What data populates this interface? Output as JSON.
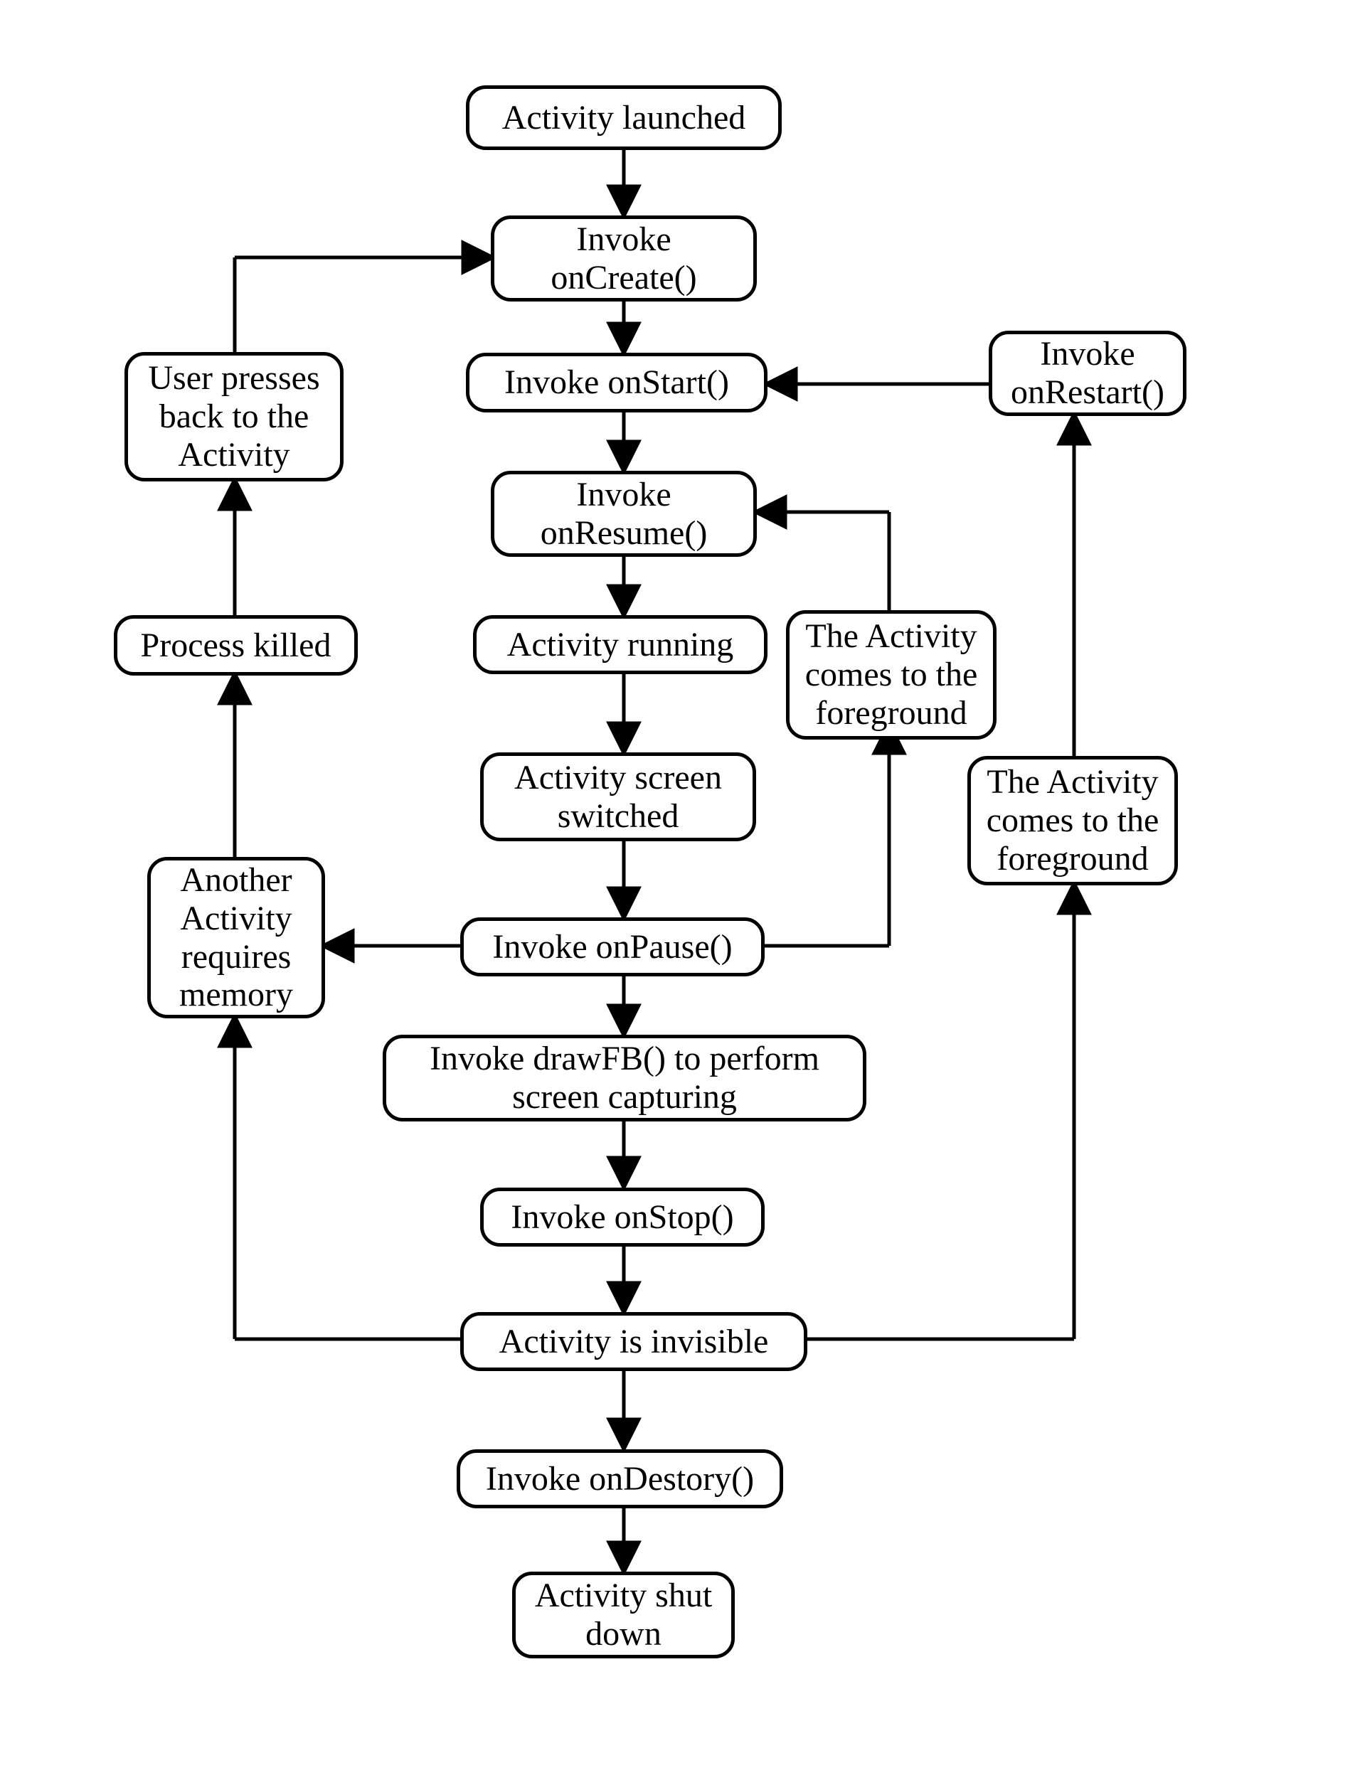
{
  "nodes": {
    "activity_launched": "Activity launched",
    "invoke_oncreate": "Invoke onCreate()",
    "invoke_onstart": "Invoke onStart()",
    "invoke_onrestart": "Invoke onRestart()",
    "invoke_onresume": "Invoke onResume()",
    "user_presses_back": "User presses back to the Activity",
    "process_killed": "Process killed",
    "activity_running": "Activity running",
    "activity_foreground_1": "The Activity comes to the foreground",
    "activity_screen_switched": "Activity screen switched",
    "another_activity_memory": "Another Activity requires memory",
    "invoke_onpause": "Invoke onPause()",
    "activity_foreground_2": "The Activity comes to the foreground",
    "invoke_drawfb": "Invoke drawFB() to perform screen capturing",
    "invoke_onstop": "Invoke onStop()",
    "activity_invisible": "Activity is invisible",
    "invoke_ondestroy": "Invoke onDestory()",
    "activity_shutdown": "Activity shut down"
  },
  "chart_data": {
    "type": "flowchart",
    "nodes": [
      {
        "id": "activity_launched",
        "label": "Activity launched"
      },
      {
        "id": "invoke_oncreate",
        "label": "Invoke onCreate()"
      },
      {
        "id": "invoke_onstart",
        "label": "Invoke onStart()"
      },
      {
        "id": "invoke_onrestart",
        "label": "Invoke onRestart()"
      },
      {
        "id": "invoke_onresume",
        "label": "Invoke onResume()"
      },
      {
        "id": "user_presses_back",
        "label": "User presses back to the Activity"
      },
      {
        "id": "process_killed",
        "label": "Process killed"
      },
      {
        "id": "activity_running",
        "label": "Activity running"
      },
      {
        "id": "activity_foreground_1",
        "label": "The Activity comes to the foreground"
      },
      {
        "id": "activity_screen_switched",
        "label": "Activity screen switched"
      },
      {
        "id": "another_activity_memory",
        "label": "Another Activity requires memory"
      },
      {
        "id": "invoke_onpause",
        "label": "Invoke onPause()"
      },
      {
        "id": "activity_foreground_2",
        "label": "The Activity comes to the foreground"
      },
      {
        "id": "invoke_drawfb",
        "label": "Invoke drawFB() to perform screen capturing"
      },
      {
        "id": "invoke_onstop",
        "label": "Invoke onStop()"
      },
      {
        "id": "activity_invisible",
        "label": "Activity is invisible"
      },
      {
        "id": "invoke_ondestroy",
        "label": "Invoke onDestory()"
      },
      {
        "id": "activity_shutdown",
        "label": "Activity shut down"
      }
    ],
    "edges": [
      {
        "from": "activity_launched",
        "to": "invoke_oncreate"
      },
      {
        "from": "invoke_oncreate",
        "to": "invoke_onstart"
      },
      {
        "from": "invoke_onstart",
        "to": "invoke_onresume"
      },
      {
        "from": "invoke_onresume",
        "to": "activity_running"
      },
      {
        "from": "activity_running",
        "to": "activity_screen_switched"
      },
      {
        "from": "activity_screen_switched",
        "to": "invoke_onpause"
      },
      {
        "from": "invoke_onpause",
        "to": "invoke_drawfb"
      },
      {
        "from": "invoke_drawfb",
        "to": "invoke_onstop"
      },
      {
        "from": "invoke_onstop",
        "to": "activity_invisible"
      },
      {
        "from": "activity_invisible",
        "to": "invoke_ondestroy"
      },
      {
        "from": "invoke_ondestroy",
        "to": "activity_shutdown"
      },
      {
        "from": "invoke_onpause",
        "to": "activity_foreground_1"
      },
      {
        "from": "activity_foreground_1",
        "to": "invoke_onresume"
      },
      {
        "from": "invoke_onpause",
        "to": "another_activity_memory"
      },
      {
        "from": "another_activity_memory",
        "to": "process_killed"
      },
      {
        "from": "process_killed",
        "to": "user_presses_back"
      },
      {
        "from": "user_presses_back",
        "to": "invoke_oncreate"
      },
      {
        "from": "activity_invisible",
        "to": "another_activity_memory"
      },
      {
        "from": "activity_invisible",
        "to": "activity_foreground_2"
      },
      {
        "from": "activity_foreground_2",
        "to": "invoke_onrestart"
      },
      {
        "from": "invoke_onrestart",
        "to": "invoke_onstart"
      }
    ]
  }
}
